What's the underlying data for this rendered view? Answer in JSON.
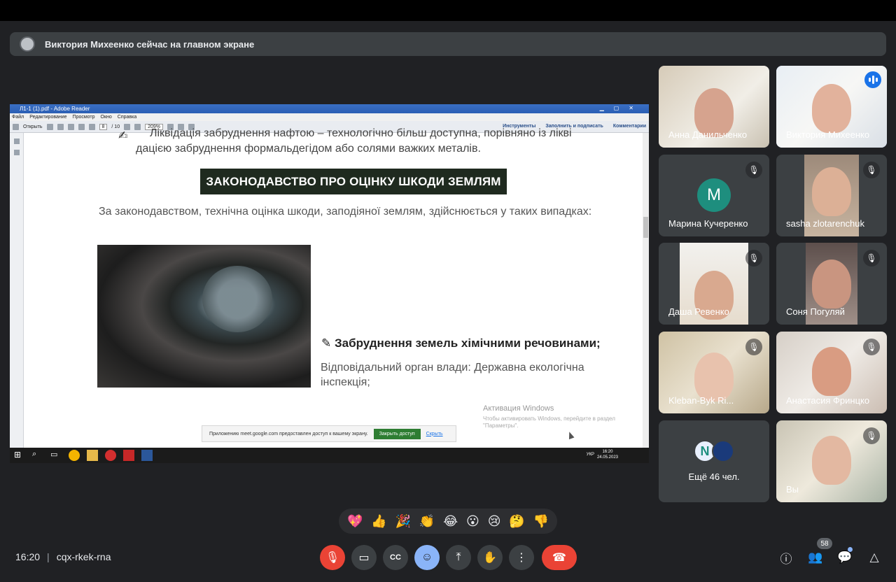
{
  "banner": {
    "text": "Виктория Михеенко сейчас на главном экране"
  },
  "shared": {
    "window_title": "Л1-1 (1).pdf - Adobe Reader",
    "menu": [
      "Файл",
      "Редактирование",
      "Просмотр",
      "Окно",
      "Справка"
    ],
    "toolbar": {
      "open": "Открыть",
      "page_current": "8",
      "page_total": "/ 10",
      "zoom": "209%",
      "tools": "Инструменты",
      "sign": "Заполнить и подписать",
      "comments": "Комментарии"
    },
    "doc": {
      "line1": "Ліквідація забруднення нафтою – технологічно більш доступна, порівняно із ліквi",
      "line2": "дацією забруднення формальдегідом або солями важких металів.",
      "heading": "ЗАКОНОДАВСТВО ПРО ОЦІНКУ ШКОДИ ЗЕМЛЯМ",
      "para": "За законодавством, технічна оцінка шкоди, заподіяної землям, здійснюється у таких випадках:",
      "bullet": "Забруднення земель хімічними речовинами;",
      "resp_line1": "Відповідальний орган влади: Державна екологічна",
      "resp_line2": "інспекція;",
      "watermark1": "Активация Windows",
      "watermark2": "Чтобы активировать Windows, перейдите в раздел",
      "watermark3": "\"Параметры\"."
    },
    "share_note": {
      "text": "Приложению meet.google.com предоставлен доступ к вашему экрану.",
      "stop": "Закрыть доступ",
      "hide": "Скрыть"
    },
    "taskbar": {
      "lang": "УКР",
      "time": "16:20",
      "date": "24.05.2023"
    }
  },
  "participants": [
    {
      "name": "Анна Данильченко",
      "muted": false
    },
    {
      "name": "Виктория Михеенко",
      "muted": false,
      "speaking": true
    },
    {
      "name": "Марина Кучеренко",
      "muted": true,
      "initial": "М"
    },
    {
      "name": "sasha zlotarenchuk",
      "muted": true
    },
    {
      "name": "Даша Ревенко",
      "muted": true
    },
    {
      "name": "Соня Погуляй",
      "muted": true
    },
    {
      "name": "Kleban-Byk Ri...",
      "muted": true
    },
    {
      "name": "Анастасия Фринцко",
      "muted": true
    },
    {
      "more_label": "Ещё 46 чел.",
      "more_initial": "N"
    },
    {
      "name": "Вы",
      "muted": true
    }
  ],
  "reactions": [
    "💖",
    "👍",
    "🎉",
    "👏",
    "😂",
    "😮",
    "😢",
    "🤔",
    "👎"
  ],
  "meeting": {
    "time": "16:20",
    "separator": "|",
    "code": "cqx-rkek-rna",
    "participant_count": "58"
  },
  "icons": {
    "mic_off": "🎙",
    "camera": "▭",
    "captions": "CC",
    "emoji": "☺",
    "present": "⤒",
    "hand": "✋",
    "more": "⋮",
    "end_call": "☎",
    "info": "ⓘ",
    "people": "👥",
    "chat": "💬",
    "activities": "△"
  }
}
